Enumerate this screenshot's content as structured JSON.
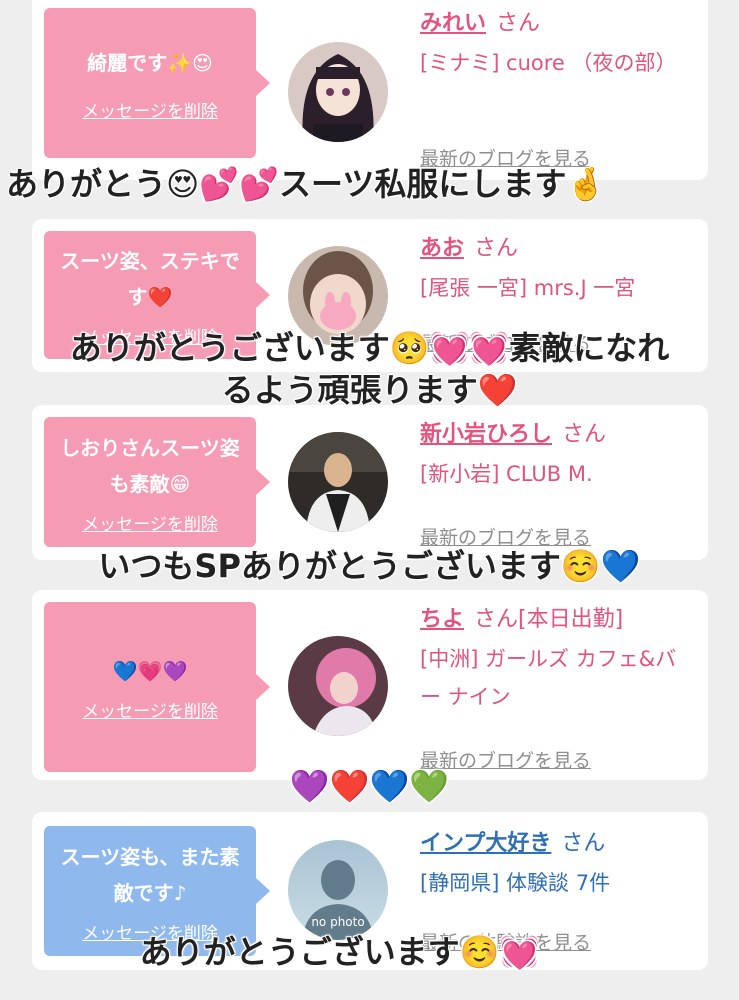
{
  "entries": [
    {
      "message": "綺麗です✨😍",
      "delete_label": "メッセージを削除",
      "name": "みれい",
      "honorific": "さん",
      "shop": "[ミナミ] cuore （夜の部）",
      "blog_link": "最新のブログを見る",
      "overlay": "ありがとう😍💕💕スーツ私服にします🤞"
    },
    {
      "message": "スーツ姿、ステキです❤️",
      "delete_label": "メッセージを削除",
      "name": "あお",
      "honorific": "さん",
      "shop": "[尾張 一宮] mrs.J 一宮",
      "blog_link": "最新のブログを見る",
      "overlay_line1": "ありがとうございます🥺💓💓素敵になれ",
      "overlay_line2": "るよう頑張ります❤️"
    },
    {
      "message": "しおりさんスーツ姿も素敵😁",
      "delete_label": "メッセージを削除",
      "name": "新小岩ひろし",
      "honorific": "さん",
      "shop": "[新小岩] CLUB M.",
      "blog_link": "最新のブログを見る",
      "overlay": "いつもSPありがとうございます☺️💙"
    },
    {
      "message": "💙💗💜",
      "delete_label": "メッセージを削除",
      "name": "ちよ",
      "honorific": "さん[本日出勤]",
      "shop": "[中洲] ガールズ カフェ&バー ナイン",
      "blog_link": "最新のブログを見る",
      "overlay": "💜❤️💙💚"
    },
    {
      "message": "スーツ姿も、また素敵です♪",
      "delete_label": "メッセージを削除",
      "name": "インプ大好き",
      "honorific": "さん",
      "shop": "[静岡県] 体験談 7件",
      "blog_link": "最新の体験談を見る",
      "no_photo": "no photo",
      "overlay": "ありがとうございます☺️💓"
    }
  ],
  "colors": {
    "pink_bubble": "#f59bb4",
    "blue_bubble": "#8fb8ec",
    "pink_name": "#e2537d",
    "blue_name": "#2f6fb5"
  }
}
